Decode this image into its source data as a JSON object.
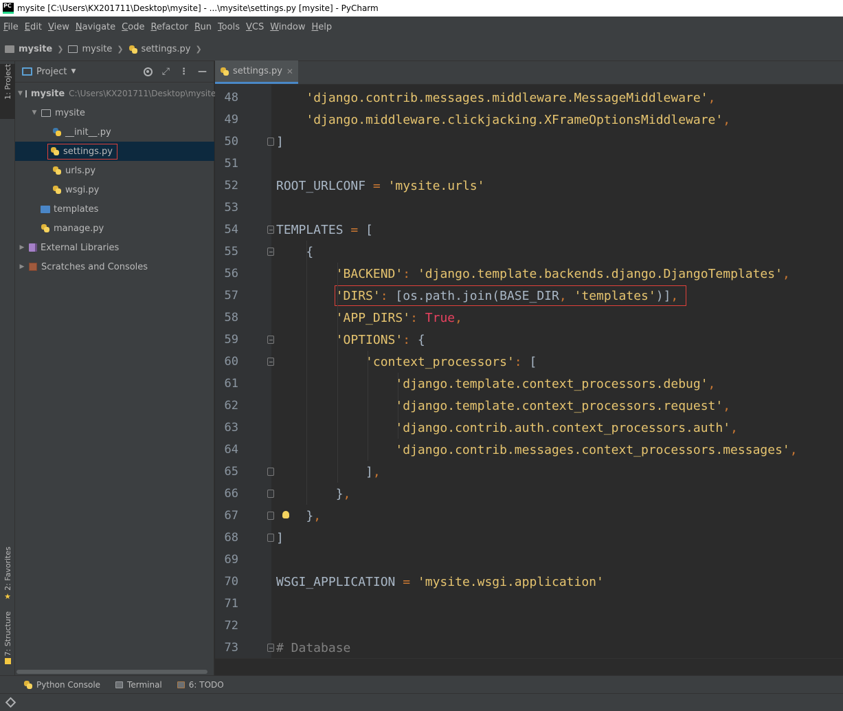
{
  "window": {
    "title": "mysite [C:\\Users\\KX201711\\Desktop\\mysite] - ...\\mysite\\settings.py [mysite] - PyCharm",
    "app_icon_text": "PC"
  },
  "menu": [
    "File",
    "Edit",
    "View",
    "Navigate",
    "Code",
    "Refactor",
    "Run",
    "Tools",
    "VCS",
    "Window",
    "Help"
  ],
  "breadcrumb": [
    "mysite",
    "mysite",
    "settings.py"
  ],
  "left_strip": {
    "project_tab": "1: Project",
    "favorites_tab": "2: Favorites",
    "structure_tab": "7: Structure"
  },
  "project_panel": {
    "title": "Project",
    "tree": [
      {
        "name": "mysite",
        "path": "C:\\Users\\KX201711\\Desktop\\mysite",
        "kind": "folder-root"
      },
      {
        "name": "mysite",
        "kind": "folder"
      },
      {
        "name": "__init__.py",
        "kind": "python"
      },
      {
        "name": "settings.py",
        "kind": "python",
        "selected": true
      },
      {
        "name": "urls.py",
        "kind": "python"
      },
      {
        "name": "wsgi.py",
        "kind": "python"
      },
      {
        "name": "templates",
        "kind": "templates-folder"
      },
      {
        "name": "manage.py",
        "kind": "python"
      },
      {
        "name": "External Libraries",
        "kind": "libraries"
      },
      {
        "name": "Scratches and Consoles",
        "kind": "scratches"
      }
    ]
  },
  "editor": {
    "tab_label": "settings.py",
    "lines": [
      {
        "n": "48",
        "text": "    'django.contrib.messages.middleware.MessageMiddleware',"
      },
      {
        "n": "49",
        "text": "    'django.middleware.clickjacking.XFrameOptionsMiddleware',"
      },
      {
        "n": "50",
        "text": "]"
      },
      {
        "n": "51",
        "text": ""
      },
      {
        "n": "52",
        "text": "ROOT_URLCONF = 'mysite.urls'"
      },
      {
        "n": "53",
        "text": ""
      },
      {
        "n": "54",
        "text": "TEMPLATES = ["
      },
      {
        "n": "55",
        "text": "    {"
      },
      {
        "n": "56",
        "text": "        'BACKEND': 'django.template.backends.django.DjangoTemplates',"
      },
      {
        "n": "57",
        "text": "        'DIRS': [os.path.join(BASE_DIR, 'templates')],"
      },
      {
        "n": "58",
        "text": "        'APP_DIRS': True,"
      },
      {
        "n": "59",
        "text": "        'OPTIONS': {"
      },
      {
        "n": "60",
        "text": "            'context_processors': ["
      },
      {
        "n": "61",
        "text": "                'django.template.context_processors.debug',"
      },
      {
        "n": "62",
        "text": "                'django.template.context_processors.request',"
      },
      {
        "n": "63",
        "text": "                'django.contrib.auth.context_processors.auth',"
      },
      {
        "n": "64",
        "text": "                'django.contrib.messages.context_processors.messages',"
      },
      {
        "n": "65",
        "text": "            ],"
      },
      {
        "n": "66",
        "text": "        },"
      },
      {
        "n": "67",
        "text": "    },"
      },
      {
        "n": "68",
        "text": "]"
      },
      {
        "n": "69",
        "text": ""
      },
      {
        "n": "70",
        "text": "WSGI_APPLICATION = 'mysite.wsgi.application'"
      },
      {
        "n": "71",
        "text": ""
      },
      {
        "n": "72",
        "text": ""
      },
      {
        "n": "73",
        "text": "# Database"
      }
    ]
  },
  "bottom_tabs": [
    "Python Console",
    "Terminal",
    "6: TODO"
  ],
  "colors": {
    "accent": "#4a88c7",
    "highlight_box": "#e0413b",
    "string": "#e6c46f",
    "keyword": "#cc7832"
  }
}
